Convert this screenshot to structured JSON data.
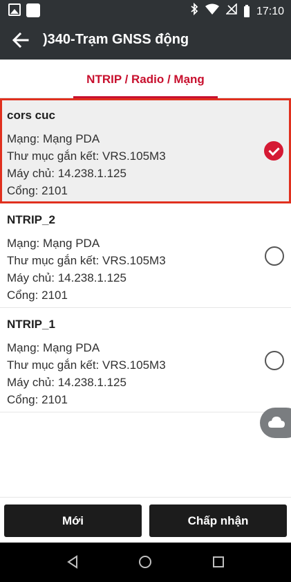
{
  "status_bar": {
    "time": "17:10",
    "icons": [
      "image-icon",
      "square-icon",
      "bluetooth-icon",
      "wifi-icon",
      "no-sim-icon",
      "battery-icon"
    ]
  },
  "app_bar": {
    "title": ")340-Trạm GNSS động",
    "back_icon": "arrow-left-icon"
  },
  "tab": {
    "label": "NTRIP / Radio / Mạng"
  },
  "colors": {
    "accent": "#c8102e",
    "selected_border": "#e0301e",
    "bar_bg": "#2f3336"
  },
  "profiles": [
    {
      "name": "cors cuc",
      "selected": true,
      "network": "Mạng:  Mạng PDA",
      "mount": "Thư mục gắn kết:  VRS.105M3",
      "host": "Máy chủ:  14.238.1.125",
      "port": "Cổng:  2101"
    },
    {
      "name": "NTRIP_2",
      "selected": false,
      "network": "Mạng:  Mạng PDA",
      "mount": "Thư mục gắn kết:  VRS.105M3",
      "host": "Máy chủ:  14.238.1.125",
      "port": "Cổng:  2101"
    },
    {
      "name": "NTRIP_1",
      "selected": false,
      "network": "Mạng:  Mạng PDA",
      "mount": "Thư mục gắn kết:  VRS.105M3",
      "host": "Máy chủ:  14.238.1.125",
      "port": "Cổng:  2101"
    }
  ],
  "fab": {
    "icon": "cloud-icon"
  },
  "actions": {
    "new_label": "Mới",
    "accept_label": "Chấp nhận"
  },
  "nav": {
    "icons": [
      "back-triangle-icon",
      "home-circle-icon",
      "recents-square-icon"
    ]
  }
}
